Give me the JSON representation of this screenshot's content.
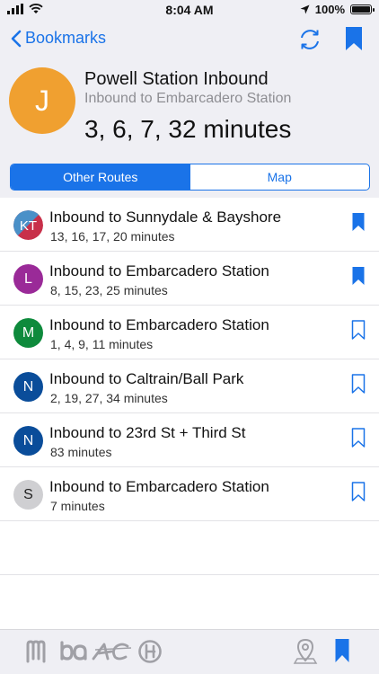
{
  "status_bar": {
    "time": "8:04 AM",
    "battery": "100%"
  },
  "nav": {
    "back_label": "Bookmarks"
  },
  "stop": {
    "initial": "J",
    "title": "Powell Station Inbound",
    "subtitle": "Inbound to Embarcadero Station",
    "times": "3, 6, 7, 32 minutes"
  },
  "tabs": {
    "other_routes": "Other Routes",
    "map": "Map"
  },
  "routes": [
    {
      "badge": "KT",
      "title": "Inbound to Sunnydale & Bayshore",
      "times": "13, 16, 17, 20 minutes",
      "bookmarked": true
    },
    {
      "badge": "L",
      "title": "Inbound to Embarcadero Station",
      "times": "8, 15, 23, 25 minutes",
      "bookmarked": true
    },
    {
      "badge": "M",
      "title": "Inbound to Embarcadero Station",
      "times": "1, 4, 9, 11 minutes",
      "bookmarked": false
    },
    {
      "badge": "N",
      "title": "Inbound to Caltrain/Ball Park",
      "times": "2, 19, 27, 34 minutes",
      "bookmarked": false
    },
    {
      "badge": "N",
      "title": "Inbound to 23rd St + Third St",
      "times": "83 minutes",
      "bookmarked": false
    },
    {
      "badge": "S",
      "title": "Inbound to Embarcadero Station",
      "times": "7 minutes",
      "bookmarked": false
    }
  ],
  "colors": {
    "accent": "#1a73e8",
    "avatar": "#f0a030",
    "kt_top": "#4a90c8",
    "kt_bottom": "#c8304a",
    "l": "#9a2a98",
    "m": "#0e8a3c",
    "n": "#0a4d9a",
    "s": "#cfcfd2"
  },
  "tab_bar_icons": [
    "muni-logo-icon",
    "bart-logo-icon",
    "ac-transit-logo-icon",
    "caltrain-logo-icon",
    "map-pin-icon",
    "bookmark-icon"
  ]
}
